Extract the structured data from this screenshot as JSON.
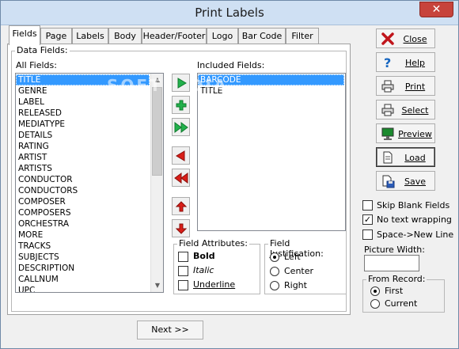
{
  "window": {
    "title": "Print Labels",
    "close_glyph": "✕"
  },
  "tabs": [
    {
      "label": "Fields"
    },
    {
      "label": "Page"
    },
    {
      "label": "Labels"
    },
    {
      "label": "Body"
    },
    {
      "label": "Header/Footer"
    },
    {
      "label": "Logo"
    },
    {
      "label": "Bar Code"
    },
    {
      "label": "Filter"
    }
  ],
  "fields_tab": {
    "data_fields_title": "Data Fields:",
    "all_fields_label": "All Fields:",
    "included_fields_label": "Included Fields:",
    "all_fields": [
      "TITLE",
      "GENRE",
      "LABEL",
      "RELEASED",
      "MEDIATYPE",
      "DETAILS",
      "RATING",
      "ARTIST",
      "ARTISTS",
      "CONDUCTOR",
      "CONDUCTORS",
      "COMPOSER",
      "COMPOSERS",
      "ORCHESTRA",
      "MORE",
      "TRACKS",
      "SUBJECTS",
      "DESCRIPTION",
      "CALLNUM",
      "UPC"
    ],
    "all_fields_selected": "TITLE",
    "included_fields": [
      "BARCODE",
      "TITLE"
    ],
    "included_selected": "BARCODE",
    "watermark": "SOFTPEDIA",
    "field_attributes": {
      "title": "Field Attributes:",
      "bold": "Bold",
      "italic": "Italic",
      "underline": "Underline"
    },
    "field_justification": {
      "title": "Field Justification:",
      "left": "Left",
      "center": "Center",
      "right": "Right",
      "selected": "Left"
    },
    "arrow_buttons": [
      {
        "name": "add-field-button",
        "icon": "green-right-triangle"
      },
      {
        "name": "insert-field-button",
        "icon": "green-plus"
      },
      {
        "name": "add-all-fields-button",
        "icon": "green-double-right"
      },
      {
        "name": "remove-field-button",
        "icon": "red-left-triangle"
      },
      {
        "name": "remove-all-fields-button",
        "icon": "red-double-left"
      },
      {
        "name": "move-up-button",
        "icon": "red-up-arrow"
      },
      {
        "name": "move-down-button",
        "icon": "red-down-arrow"
      }
    ]
  },
  "side_buttons": {
    "close": "Close",
    "help": "Help",
    "print": "Print",
    "select": "Select",
    "preview": "Preview",
    "load": "Load",
    "save": "Save"
  },
  "options": {
    "skip_blank": "Skip Blank Fields",
    "no_wrap": "No text wrapping",
    "space_newline": "Space->New Line",
    "skip_blank_checked": false,
    "no_wrap_checked": true,
    "space_newline_checked": false,
    "picture_width_label": "Picture Width:",
    "picture_width_value": "",
    "from_record_title": "From Record:",
    "first": "First",
    "current": "Current",
    "from_record_selected": "First"
  },
  "footer": {
    "next_label": "Next >>"
  },
  "colors": {
    "selection": "#3399ff",
    "green_arrow": "#22b14c",
    "red_arrow": "#d91e18",
    "close_x": "#c7433b"
  }
}
